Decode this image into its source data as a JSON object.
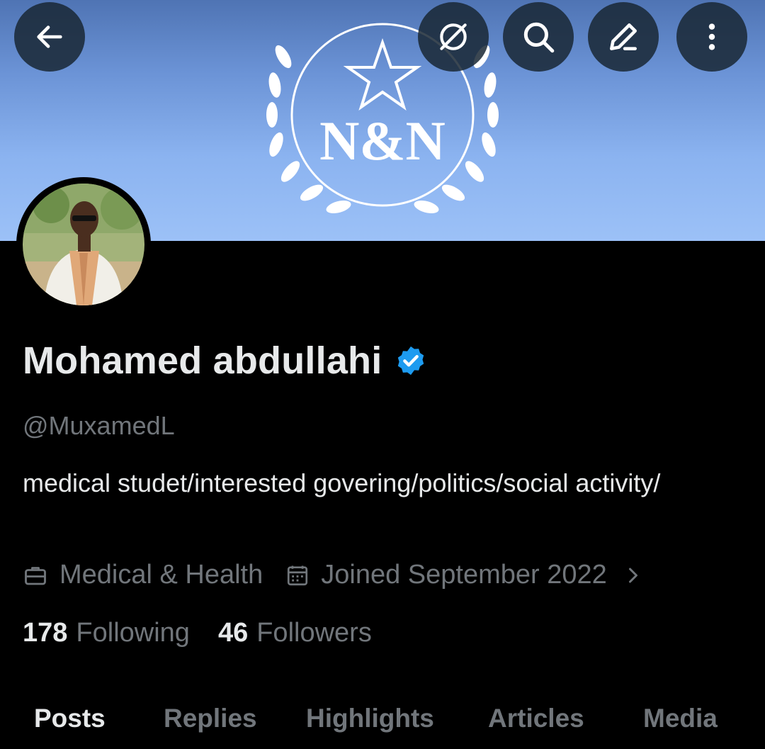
{
  "header": {
    "banner_logo_text": "N&N",
    "banner_color": "#8bb3f0",
    "buttons": {
      "back": "back-arrow-icon",
      "grok": "grok-icon",
      "search": "search-icon",
      "edit": "edit-pencil-icon",
      "more": "more-vertical-icon"
    }
  },
  "profile": {
    "display_name": "Mohamed abdullahi",
    "verified": true,
    "verified_color": "#1d9bf0",
    "handle": "@MuxamedL",
    "bio": "medical studet/interested govering/politics/social activity/",
    "category": "Medical & Health",
    "joined": "Joined September 2022",
    "following_count": "178",
    "following_label": "Following",
    "followers_count": "46",
    "followers_label": "Followers"
  },
  "tabs": [
    {
      "label": "Posts",
      "active": true
    },
    {
      "label": "Replies",
      "active": false
    },
    {
      "label": "Highlights",
      "active": false
    },
    {
      "label": "Articles",
      "active": false
    },
    {
      "label": "Media",
      "active": false
    }
  ],
  "colors": {
    "background": "#000000",
    "text_primary": "#e7e9ea",
    "text_secondary": "#71767b",
    "accent": "#1d9bf0"
  }
}
